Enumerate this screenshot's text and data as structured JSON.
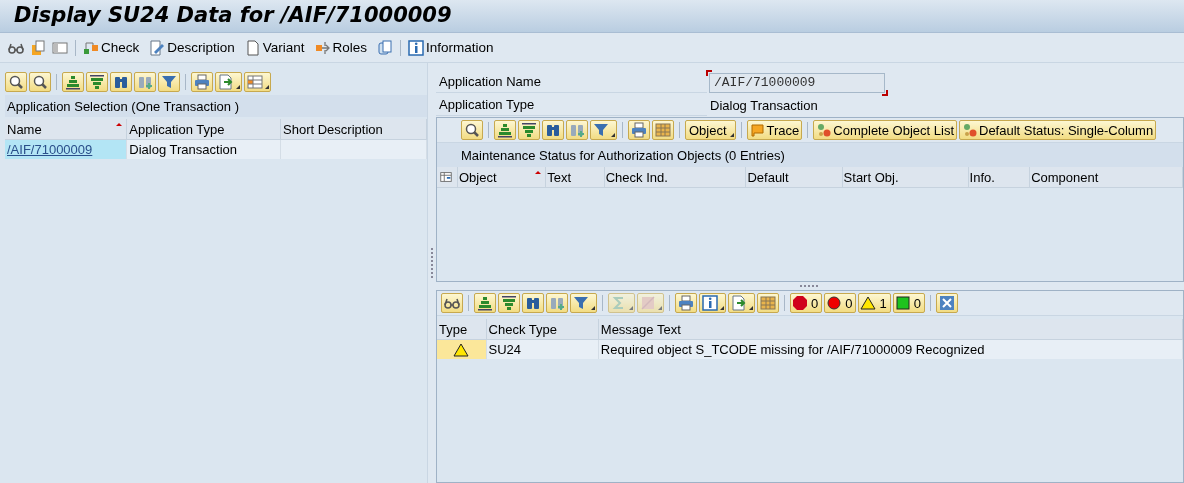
{
  "title": "Display SU24 Data for /AIF/71000009",
  "main_toolbar": [
    {
      "label": "Check"
    },
    {
      "label": "Description"
    },
    {
      "label": "Variant"
    },
    {
      "label": "Roles"
    },
    {
      "label": "Information"
    }
  ],
  "applications": {
    "header": "Application Selection (One Transaction )",
    "columns": [
      "Name",
      "Application Type",
      "Short Description"
    ],
    "rows": [
      {
        "name": "/AIF/71000009",
        "application_type": "Dialog Transaction",
        "short_description": ""
      }
    ]
  },
  "details": {
    "application_name_label": "Application Name",
    "application_name": "/AIF/71000009",
    "application_type_label": "Application Type",
    "application_type": "Dialog Transaction"
  },
  "maintenance": {
    "buttons": [
      {
        "label": "Object",
        "kind": "menu"
      },
      {
        "label": "Trace",
        "kind": "trace"
      },
      {
        "label": "Complete Object List",
        "kind": "objects"
      },
      {
        "label": "Default Status: Single-Column",
        "kind": "objects"
      }
    ],
    "header": "Maintenance Status for Authorization Objects (0 Entries)",
    "columns": [
      "Object",
      "Text",
      "Check Ind.",
      "Default",
      "Start Obj.",
      "Info.",
      "Component"
    ]
  },
  "messages": {
    "counts": [
      {
        "kind": "stop",
        "count": "0"
      },
      {
        "kind": "error",
        "count": "0"
      },
      {
        "kind": "warning",
        "count": "1"
      },
      {
        "kind": "success",
        "count": "0"
      }
    ],
    "columns": [
      "Type",
      "Check Type",
      "Message Text"
    ],
    "rows": [
      {
        "kind": "warning",
        "check_type": "SU24",
        "message_text": "Required object S_TCODE missing for /AIF/71000009 Recognized"
      }
    ]
  }
}
